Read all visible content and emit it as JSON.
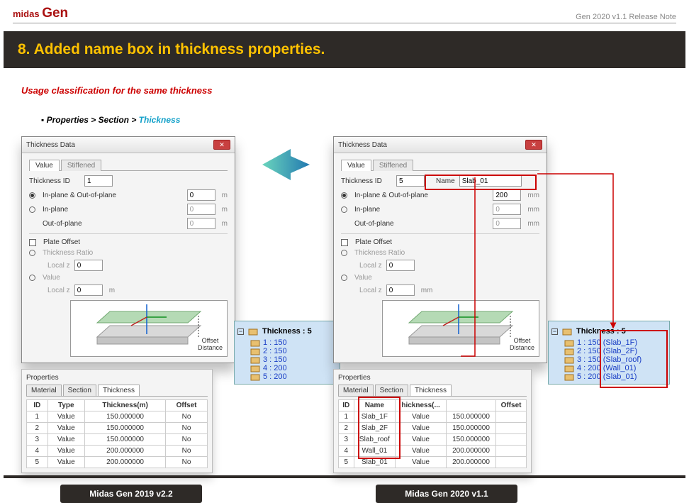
{
  "header": {
    "logo_prefix": "midas",
    "logo_main": "Gen",
    "release": "Gen 2020 v1.1 Release Note"
  },
  "title": "8. Added name box in thickness properties.",
  "subtitle": "Usage classification for the same thickness",
  "breadcrumb": {
    "a": "Properties",
    "b": "Section",
    "c": "Thickness"
  },
  "dialog_title": "Thickness Data",
  "tabs": {
    "value": "Value",
    "stiff": "Stiffened"
  },
  "labels": {
    "thk_id": "Thickness ID",
    "name": "Name",
    "iopo": "In-plane & Out-of-plane",
    "ip": "In-plane",
    "oop": "Out-of-plane",
    "plate": "Plate Offset",
    "tratio": "Thickness Ratio",
    "localz": "Local z",
    "val": "Value",
    "m": "m",
    "mm": "mm",
    "off_dist": "Offset\nDistance"
  },
  "left": {
    "id": "1",
    "io_val": "0",
    "ip_val": "0",
    "oop_val": "0",
    "lz1": "0",
    "lz2": "0",
    "units": "m",
    "tree_head": "Thickness : 5",
    "tree": [
      "1 : 150",
      "2 : 150",
      "3 : 150",
      "4 : 200",
      "5 : 200"
    ],
    "props_tabs": [
      "Material",
      "Section",
      "Thickness"
    ],
    "table_head": [
      "ID",
      "Type",
      "Thickness(m)",
      "Offset"
    ],
    "table": [
      [
        "1",
        "Value",
        "150.000000",
        "No"
      ],
      [
        "2",
        "Value",
        "150.000000",
        "No"
      ],
      [
        "3",
        "Value",
        "150.000000",
        "No"
      ],
      [
        "4",
        "Value",
        "200.000000",
        "No"
      ],
      [
        "5",
        "Value",
        "200.000000",
        "No"
      ]
    ],
    "version": "Midas Gen 2019 v2.2"
  },
  "right": {
    "id": "5",
    "name": "Slab_01",
    "io_val": "200",
    "ip_val": "0",
    "oop_val": "0",
    "lz1": "0",
    "lz2": "0",
    "units": "mm",
    "tree_head": "Thickness : 5",
    "tree": [
      "1 : 150 (Slab_1F)",
      "2 : 150 (Slab_2F)",
      "3 : 150 (Slab_roof)",
      "4 : 200 (Wall_01)",
      "5 : 200 (Slab_01)"
    ],
    "props_tabs": [
      "Material",
      "Section",
      "Thickness"
    ],
    "table_head": [
      "ID",
      "Name",
      "hickness(...",
      "",
      "Offset"
    ],
    "table": [
      [
        "1",
        "Slab_1F",
        "Value",
        "150.000000",
        ""
      ],
      [
        "2",
        "Slab_2F",
        "Value",
        "150.000000",
        ""
      ],
      [
        "3",
        "Slab_roof",
        "Value",
        "150.000000",
        ""
      ],
      [
        "4",
        "Wall_01",
        "Value",
        "200.000000",
        ""
      ],
      [
        "5",
        "Slab_01",
        "Value",
        "200.000000",
        ""
      ]
    ],
    "version": "Midas Gen 2020 v1.1"
  },
  "props_label": "Properties"
}
